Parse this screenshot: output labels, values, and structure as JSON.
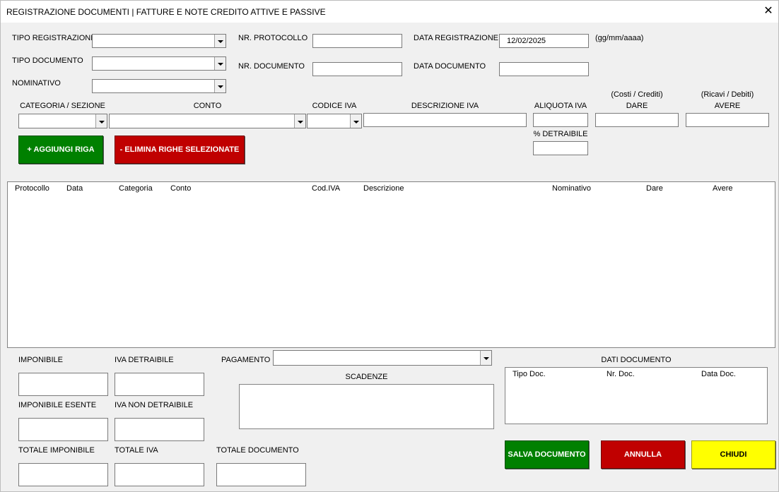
{
  "window": {
    "title": "REGISTRAZIONE DOCUMENTI | FATTURE E NOTE CREDITO ATTIVE E PASSIVE",
    "close_glyph": "✕"
  },
  "header": {
    "tipo_registrazione_label": "TIPO REGISTRAZIONE",
    "tipo_documento_label": "TIPO DOCUMENTO",
    "nominativo_label": "NOMINATIVO",
    "nr_protocollo_label": "NR. PROTOCOLLO",
    "nr_documento_label": "NR. DOCUMENTO",
    "data_registrazione_label": "DATA REGISTRAZIONE",
    "data_registrazione_value": "12/02/2025",
    "data_format_hint": "(gg/mm/aaaa)",
    "data_documento_label": "DATA DOCUMENTO"
  },
  "row_entry": {
    "categoria_label": "CATEGORIA / SEZIONE",
    "conto_label": "CONTO",
    "codice_iva_label": "CODICE IVA",
    "descrizione_iva_label": "DESCRIZIONE  IVA",
    "aliquota_label": "ALIQUOTA IVA",
    "dare_hint": "(Costi / Crediti)",
    "dare_label": "DARE",
    "avere_hint": "(Ricavi / Debiti)",
    "avere_label": "AVERE",
    "detraibile_label": "% DETRAIBILE",
    "add_button": "+ AGGIUNGI RIGA",
    "delete_button": "- ELIMINA RIGHE SELEZIONATE"
  },
  "list": {
    "columns": [
      "Protocollo",
      "Data",
      "Categoria",
      "Conto",
      "Cod.IVA",
      "Descrizione",
      "Nominativo",
      "Dare",
      "Avere"
    ]
  },
  "totals": {
    "imponibile": "IMPONIBILE",
    "iva_detraibile": "IVA DETRAIBILE",
    "imponibile_esente": "IMPONIBILE ESENTE",
    "iva_non_detraibile": "IVA NON DETRAIBILE",
    "totale_imponibile": "TOTALE IMPONIBILE",
    "totale_iva": "TOTALE IVA",
    "totale_documento": "TOTALE DOCUMENTO"
  },
  "payment": {
    "pagamento_label": "PAGAMENTO",
    "scadenze_label": "SCADENZE"
  },
  "dati_documento": {
    "title": "DATI DOCUMENTO",
    "columns": [
      "Tipo Doc.",
      "Nr. Doc.",
      "Data Doc."
    ]
  },
  "actions": {
    "save": "SALVA DOCUMENTO",
    "cancel": "ANNULLA",
    "close": "CHIUDI"
  },
  "colors": {
    "green": "#008000",
    "red": "#c00000",
    "yellow": "#ffff00",
    "background": "#f0f0f0"
  }
}
